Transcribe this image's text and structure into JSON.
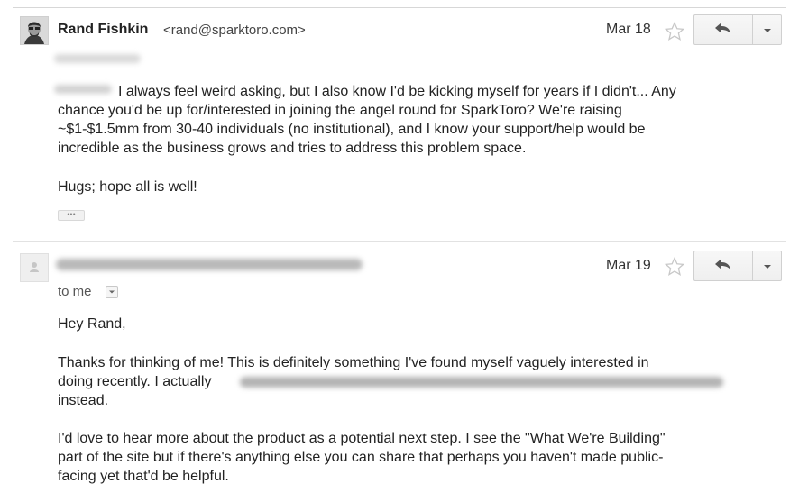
{
  "message1": {
    "sender_name": "Rand Fishkin",
    "sender_email": "<rand@sparktoro.com>",
    "date": "Mar 18",
    "body_lines": [
      "I always feel weird asking, but I also know I'd be kicking myself for years if I didn't... Any",
      "chance you'd be up for/interested in joining the angel round for SparkToro? We're raising",
      "~$1-$1.5mm from 30-40 individuals (no institutional), and I know your support/help would be",
      "incredible as the business grows and tries to address this problem space."
    ],
    "signoff": "Hugs; hope all is well!",
    "show_trimmed_label": "•••"
  },
  "message2": {
    "date": "Mar 19",
    "to_label": "to me",
    "greeting": "Hey Rand,",
    "para1_lines": [
      "Thanks for thinking of me! This is definitely something I've found myself vaguely interested in",
      "doing recently. I actually",
      "instead."
    ],
    "para2_lines": [
      "I'd love to hear more about the product as a potential next step. I see the \"What We're Building\"",
      "part of the site but if there's anything else you can share that perhaps you haven't made public-",
      "facing yet that'd be helpful."
    ]
  },
  "icons": {
    "star": "star-outline-icon",
    "reply": "reply-arrow-icon",
    "more": "caret-down-icon",
    "avatar_default": "person-silhouette-icon"
  },
  "colors": {
    "text": "#222222",
    "divider": "#d7d7d7",
    "button_border": "#d0d0d0",
    "star": "#c8c8c8"
  }
}
